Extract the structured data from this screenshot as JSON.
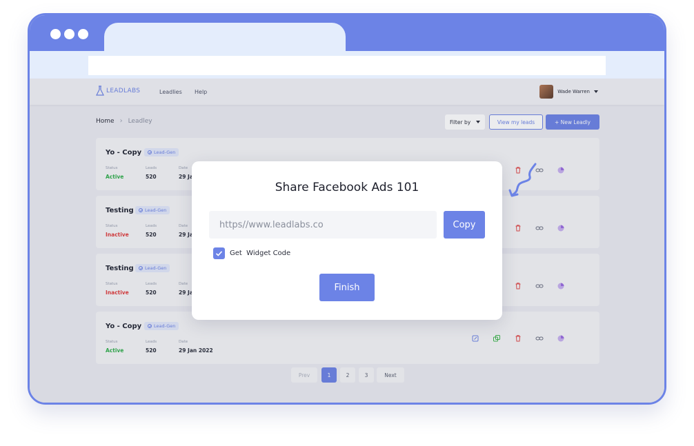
{
  "brand": {
    "name": "LEADLABS",
    "accent": "#6c83e6"
  },
  "nav": {
    "leadlies": "Leadlies",
    "help": "Help"
  },
  "user": {
    "name": "Wade Warren"
  },
  "breadcrumb": {
    "home": "Home",
    "current": "Leadley"
  },
  "toolbar": {
    "filter": "Filter by",
    "view_leads": "View my leads",
    "new_leadly": "+ New Leadly"
  },
  "meta_labels": {
    "status": "Status",
    "leads": "Leads",
    "date": "Date"
  },
  "cards": [
    {
      "name": "Yo - Copy",
      "tag": "Lead-Gen",
      "status": "Active",
      "leads": "520",
      "date": "29 Ja"
    },
    {
      "name": "Testing",
      "tag": "Lead-Gen",
      "status": "Inactive",
      "leads": "520",
      "date": "29 Ja"
    },
    {
      "name": "Testing",
      "tag": "Lead-Gen",
      "status": "Inactive",
      "leads": "520",
      "date": "29 Ja"
    },
    {
      "name": "Yo - Copy",
      "tag": "Lead-Gen",
      "status": "Active",
      "leads": "520",
      "date": "29 Jan 2022"
    }
  ],
  "pagination": {
    "prev": "Prev",
    "pages": [
      "1",
      "2",
      "3"
    ],
    "next": "Next",
    "current": "1"
  },
  "modal": {
    "title": "Share Facebook Ads 101",
    "link_placeholder": "https//www.leadlabs.co",
    "copy_label": "Copy",
    "widget_label": "Get  Widget Code",
    "widget_checked": true,
    "finish_label": "Finish"
  },
  "colors": {
    "active": "#2fae4a",
    "inactive": "#e03b3b",
    "edit": "#6c83e6",
    "duplicate": "#3bb54a",
    "delete": "#e04848",
    "link": "#6a6f80",
    "stats": "#9b6be0"
  }
}
